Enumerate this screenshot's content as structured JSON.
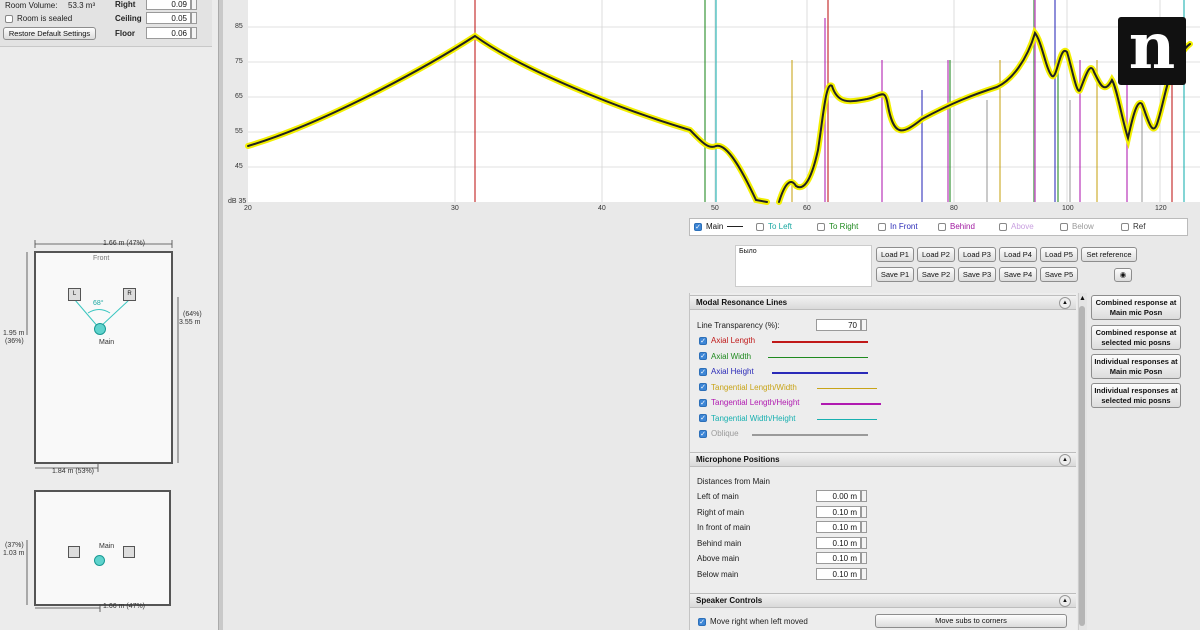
{
  "room_settings": {
    "room_volume_label": "Room Volume:",
    "room_volume_value": "53.3 m³",
    "room_sealed_label": "Room is sealed",
    "restore_button": "Restore Default Settings",
    "right_label": "Right",
    "right_value": "0.09",
    "ceiling_label": "Ceiling",
    "ceiling_value": "0.05",
    "floor_label": "Floor",
    "floor_value": "0.06"
  },
  "plan_view": {
    "width_top": "1.66 m (47%)",
    "front_label": "Front",
    "left_speaker": "L",
    "right_speaker": "R",
    "angle": "68°",
    "mic_label": "Main",
    "left_dim_line1": "1.95 m",
    "left_dim_line2": "(36%)",
    "right_dim_line1": "(64%)",
    "right_dim_line2": "3.55 m",
    "bottom_dim": "1.84 m (53%)"
  },
  "side_view": {
    "left_dim_line1": "(37%)",
    "left_dim_line2": "1.03 m",
    "mic_label": "Main",
    "bottom_dim": "1.66 m (47%)"
  },
  "graph": {
    "y_ticks": [
      "85",
      "75",
      "65",
      "55",
      "45",
      "dB 35"
    ],
    "x_ticks": [
      "20",
      "30",
      "40",
      "50",
      "60",
      "80",
      "100",
      "120"
    ]
  },
  "legend": {
    "main": "Main",
    "to_left": "To Left",
    "to_right": "To Right",
    "in_front": "In Front",
    "behind": "Behind",
    "above": "Above",
    "below": "Below",
    "ref": "Ref"
  },
  "notes_text": "Было",
  "presets": {
    "load": [
      "Load P1",
      "Load P2",
      "Load P3",
      "Load P4",
      "Load P5"
    ],
    "save": [
      "Save P1",
      "Save P2",
      "Save P3",
      "Save P4",
      "Save P5"
    ],
    "set_reference": "Set reference"
  },
  "modal_panel": {
    "title": "Modal Resonance Lines",
    "transparency_label": "Line Transparency (%):",
    "transparency_value": "70",
    "lines": [
      {
        "label": "Axial Length",
        "color": "#c01818"
      },
      {
        "label": "Axial Width",
        "color": "#1f8a1f"
      },
      {
        "label": "Axial Height",
        "color": "#2a2ab8"
      },
      {
        "label": "Tangential Length/Width",
        "color": "#c8a418"
      },
      {
        "label": "Tangential Length/Height",
        "color": "#b01ab0"
      },
      {
        "label": "Tangential Width/Height",
        "color": "#18b0b0"
      },
      {
        "label": "Oblique",
        "color": "#9a9a9a"
      }
    ]
  },
  "mic_panel": {
    "title": "Microphone Positions",
    "subtitle": "Distances from Main",
    "rows": [
      {
        "label": "Left of main",
        "value": "0.00 m"
      },
      {
        "label": "Right of main",
        "value": "0.10 m"
      },
      {
        "label": "In front of main",
        "value": "0.10 m"
      },
      {
        "label": "Behind main",
        "value": "0.10 m"
      },
      {
        "label": "Above main",
        "value": "0.10 m"
      },
      {
        "label": "Below main",
        "value": "0.10 m"
      }
    ]
  },
  "speaker_panel": {
    "title": "Speaker Controls",
    "move_right_label": "Move right when left moved",
    "move_subs_button": "Move subs to corners"
  },
  "side_buttons": [
    {
      "line1": "Combined response at",
      "line2": "Main mic Posn"
    },
    {
      "line1": "Combined response at",
      "line2": "selected mic posns"
    },
    {
      "line1": "Individual responses at",
      "line2": "Main mic Posn"
    },
    {
      "line1": "Individual responses at",
      "line2": "selected mic posns"
    }
  ],
  "logo_letter": "n",
  "colors": {
    "response_curve": "#222222",
    "curve_highlight": "#f2ef00",
    "check_blue": "#3d86d6"
  }
}
